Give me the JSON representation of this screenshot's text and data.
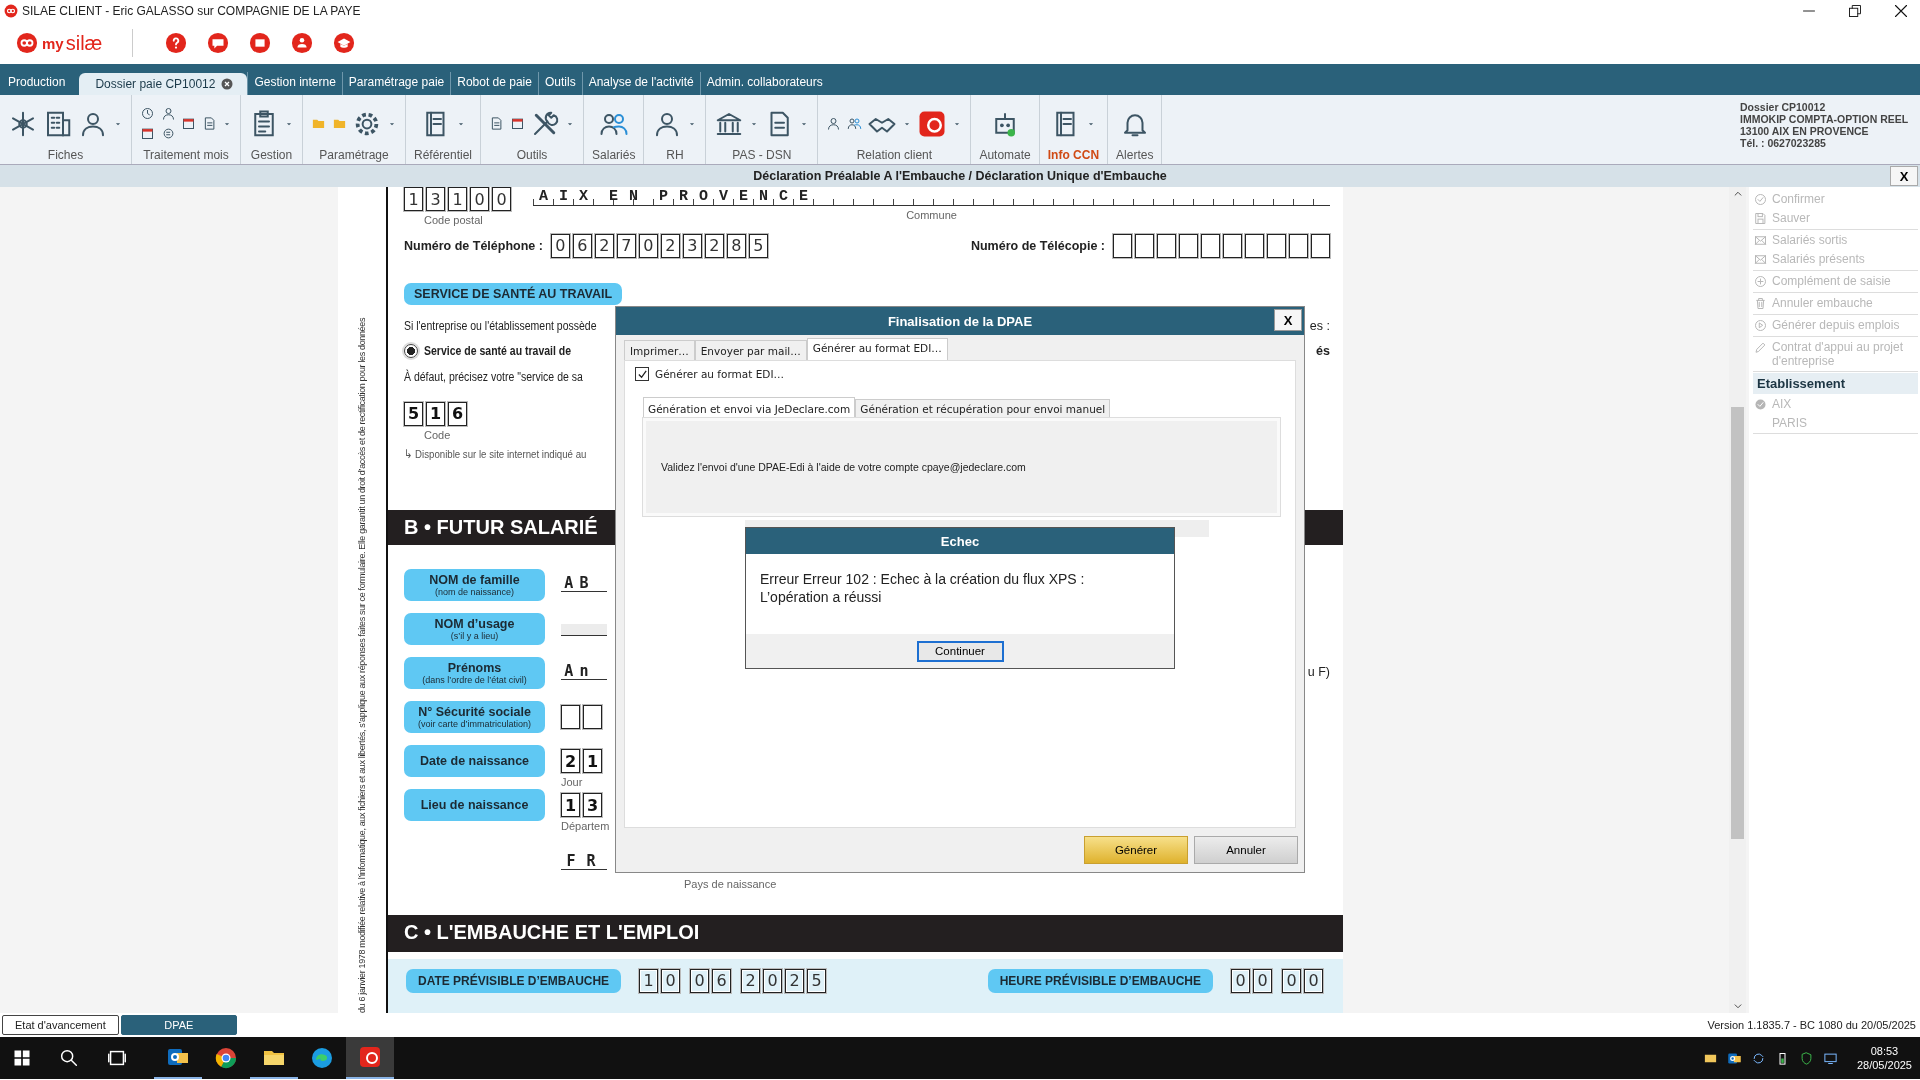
{
  "window": {
    "title": "SILAE CLIENT - Eric GALASSO sur COMPAGNIE DE LA PAYE"
  },
  "logo": {
    "prefix": "my",
    "name": "silæ"
  },
  "tabs": [
    {
      "label": "Production",
      "selected": false
    },
    {
      "label": "Dossier paie CP10012",
      "selected": true,
      "closable": true
    },
    {
      "label": "Gestion interne",
      "selected": false
    },
    {
      "label": "Paramétrage paie",
      "selected": false
    },
    {
      "label": "Robot de paie",
      "selected": false
    },
    {
      "label": "Outils",
      "selected": false
    },
    {
      "label": "Analyse de l'activité",
      "selected": false
    },
    {
      "label": "Admin. collaborateurs",
      "selected": false
    }
  ],
  "ribbon": [
    {
      "label": "Fiches"
    },
    {
      "label": "Traitement mois"
    },
    {
      "label": "Gestion"
    },
    {
      "label": "Paramétrage"
    },
    {
      "label": "Référentiel"
    },
    {
      "label": "Outils"
    },
    {
      "label": "Salariés"
    },
    {
      "label": "RH"
    },
    {
      "label": "PAS - DSN"
    },
    {
      "label": "Relation client"
    },
    {
      "label": "Automate"
    },
    {
      "label": "Info CCN",
      "highlight": true
    },
    {
      "label": "Alertes"
    }
  ],
  "dossier": [
    "Dossier CP10012",
    "IMMOKIP COMPTA-OPTION REEL",
    "13100 AIX EN PROVENCE",
    "Tél. : 0627023285"
  ],
  "document": {
    "title": "Déclaration Préalable A l'Embauche / Déclaration Unique d'Embauche",
    "close": "X"
  },
  "form": {
    "legal_notice": "du 6 janvier 1978 modifiée relative à l’informatique, aux fichiers et aux libertés, s’applique aux réponses faites sur ce formulaire. Elle garantit un droit d’accès et de rectification pour les données",
    "postal_code": [
      "1",
      "3",
      "1",
      "0",
      "0"
    ],
    "postal_code_label": "Code postal",
    "commune": "A I X  E N  P R O V E N C E",
    "commune_label": "Commune",
    "phone": {
      "label": "Numéro de Téléphone :",
      "digits": [
        "0",
        "6",
        "2",
        "7",
        "0",
        "2",
        "3",
        "2",
        "8",
        "5"
      ]
    },
    "fax": {
      "label": "Numéro de Télécopie :"
    },
    "health_service": {
      "title": "SERVICE DE SANTÉ AU TRAVAIL",
      "intro": "Si l'entreprise ou l'établissement possède",
      "intro_end": "es :",
      "option": {
        "label": "Service de santé au travail de",
        "label_end": "és",
        "selected": true
      },
      "fallback": "À défaut, précisez votre \"service de sa",
      "code": [
        "5",
        "1",
        "6"
      ],
      "code_label": "Code",
      "hint": "↳ Disponible sur le site internet indiqué au"
    },
    "section_b": {
      "title": "B • FUTUR SALARIÉ",
      "fields": [
        {
          "label": "NOM de famille",
          "sub": "(nom de naissance)",
          "kind": "comb",
          "chars": [
            "A",
            "B"
          ]
        },
        {
          "label": "NOM d’usage",
          "sub": "(s’il y a lieu)",
          "kind": "comb"
        },
        {
          "label": "Prénoms",
          "sub": "(dans l’ordre de l’état civil)",
          "kind": "comb",
          "chars": [
            "A",
            "n"
          ],
          "trailing": "u F)"
        },
        {
          "label": "N° Sécurité sociale",
          "sub": "(voir carte d’immatriculation)",
          "kind": "boxes"
        },
        {
          "label": "Date de naissance",
          "kind": "digits",
          "chars": [
            "2",
            "1"
          ],
          "caption": "Jour"
        },
        {
          "label": "Lieu de naissance",
          "kind": "digits",
          "chars": [
            "1",
            "3"
          ],
          "caption": "Départem"
        }
      ],
      "country": {
        "chars": [
          "F",
          "R"
        ],
        "caption": "Pays de naissance"
      }
    },
    "section_c": {
      "title": "C • L'EMBAUCHE ET L'EMPLOI",
      "hire_date": {
        "label": "DATE PRÉVISIBLE D’EMBAUCHE",
        "groups": [
          [
            "1",
            "0"
          ],
          [
            "0",
            "6"
          ],
          [
            "2",
            "0",
            "2",
            "5"
          ]
        ]
      },
      "hire_time": {
        "label": "HEURE PRÉVISIBLE D’EMBAUCHE",
        "groups": [
          [
            "0",
            "0"
          ],
          [
            "0",
            "0"
          ]
        ]
      }
    }
  },
  "side_panel": {
    "action_groups": [
      [
        {
          "label": "Confirmer",
          "disabled": true
        },
        {
          "label": "Sauver",
          "disabled": true
        }
      ],
      [
        {
          "label": "Salariés sortis",
          "disabled": true
        },
        {
          "label": "Salariés présents",
          "disabled": true
        }
      ],
      [
        {
          "label": "Complément de saisie",
          "disabled": true
        }
      ],
      [
        {
          "label": "Annuler embauche",
          "disabled": true
        }
      ],
      [
        {
          "label": "Générer depuis emplois",
          "disabled": true
        }
      ],
      [
        {
          "label": "Contrat d'appui au projet d'entreprise",
          "disabled": true
        }
      ]
    ],
    "establishment": {
      "title": "Etablissement",
      "items": [
        {
          "label": "AIX",
          "selected": true,
          "disabled": true
        },
        {
          "label": "PARIS",
          "selected": false,
          "disabled": true
        }
      ]
    }
  },
  "dialog": {
    "title": "Finalisation de la DPAE",
    "close": "X",
    "tabs": [
      {
        "label": "Imprimer…",
        "selected": false
      },
      {
        "label": "Envoyer par mail…",
        "selected": false
      },
      {
        "label": "Générer au format EDI…",
        "selected": true
      }
    ],
    "checkbox": {
      "label": "Générer au format EDI…",
      "checked": true
    },
    "subtabs": [
      {
        "label": "Génération et envoi via JeDeclare.com",
        "selected": true
      },
      {
        "label": "Génération et récupération pour envoi manuel",
        "selected": false
      }
    ],
    "message": "Validez l'envoi d'une DPAE-Edi à l'aide de votre compte cpaye@jedeclare.com",
    "buttons": [
      {
        "label": "Générer",
        "primary": true
      },
      {
        "label": "Annuler",
        "primary": false
      }
    ]
  },
  "error_dialog": {
    "title": "Echec",
    "lines": [
      "Erreur Erreur 102 : Echec à la création du flux XPS :",
      "L’opération a réussi"
    ],
    "button": "Continuer"
  },
  "status_bar": {
    "tabs": [
      {
        "label": "Etat d'avancement",
        "selected": false
      },
      {
        "label": "DPAE",
        "selected": true
      }
    ],
    "version": "Version 1.1835.7 - BC 1080 du 20/05/2025"
  },
  "taskbar": {
    "apps": [
      {
        "running": true,
        "active": false
      },
      {
        "running": false,
        "active": false
      },
      {
        "running": true,
        "active": false
      },
      {
        "running": false,
        "active": false
      },
      {
        "running": true,
        "active": true
      }
    ],
    "time": "08:53",
    "date": "28/05/2025"
  }
}
